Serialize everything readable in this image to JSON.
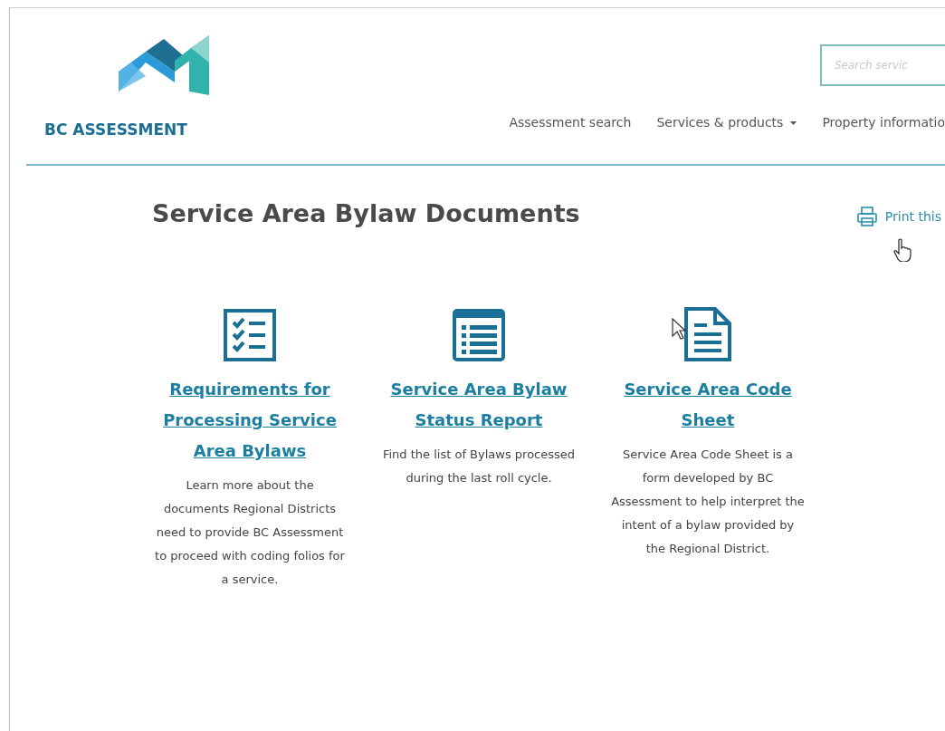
{
  "header": {
    "brand": "BC ASSESSMENT",
    "search": {
      "placeholder": "Search servic"
    },
    "nav": [
      {
        "label": "Assessment search",
        "dropdown": false
      },
      {
        "label": "Services & products",
        "dropdown": true
      },
      {
        "label": "Property informatio",
        "dropdown": false
      }
    ]
  },
  "page": {
    "title": "Service Area Bylaw Documents",
    "print_link": "Print this"
  },
  "cards": [
    {
      "kind": "checklist",
      "title": "Requirements for Processing Service Area Bylaws",
      "description": "Learn more about the documents Regional Districts need to provide BC Assessment to proceed with coding folios for a service."
    },
    {
      "kind": "list",
      "title": "Service Area Bylaw Status Report",
      "description": "Find the list of Bylaws processed during the last roll cycle."
    },
    {
      "kind": "document",
      "title": "Service Area Code Sheet",
      "description": "Service Area Code Sheet is a form developed by BC Assessment to help interpret the intent of a bylaw provided by the Regional District."
    }
  ]
}
